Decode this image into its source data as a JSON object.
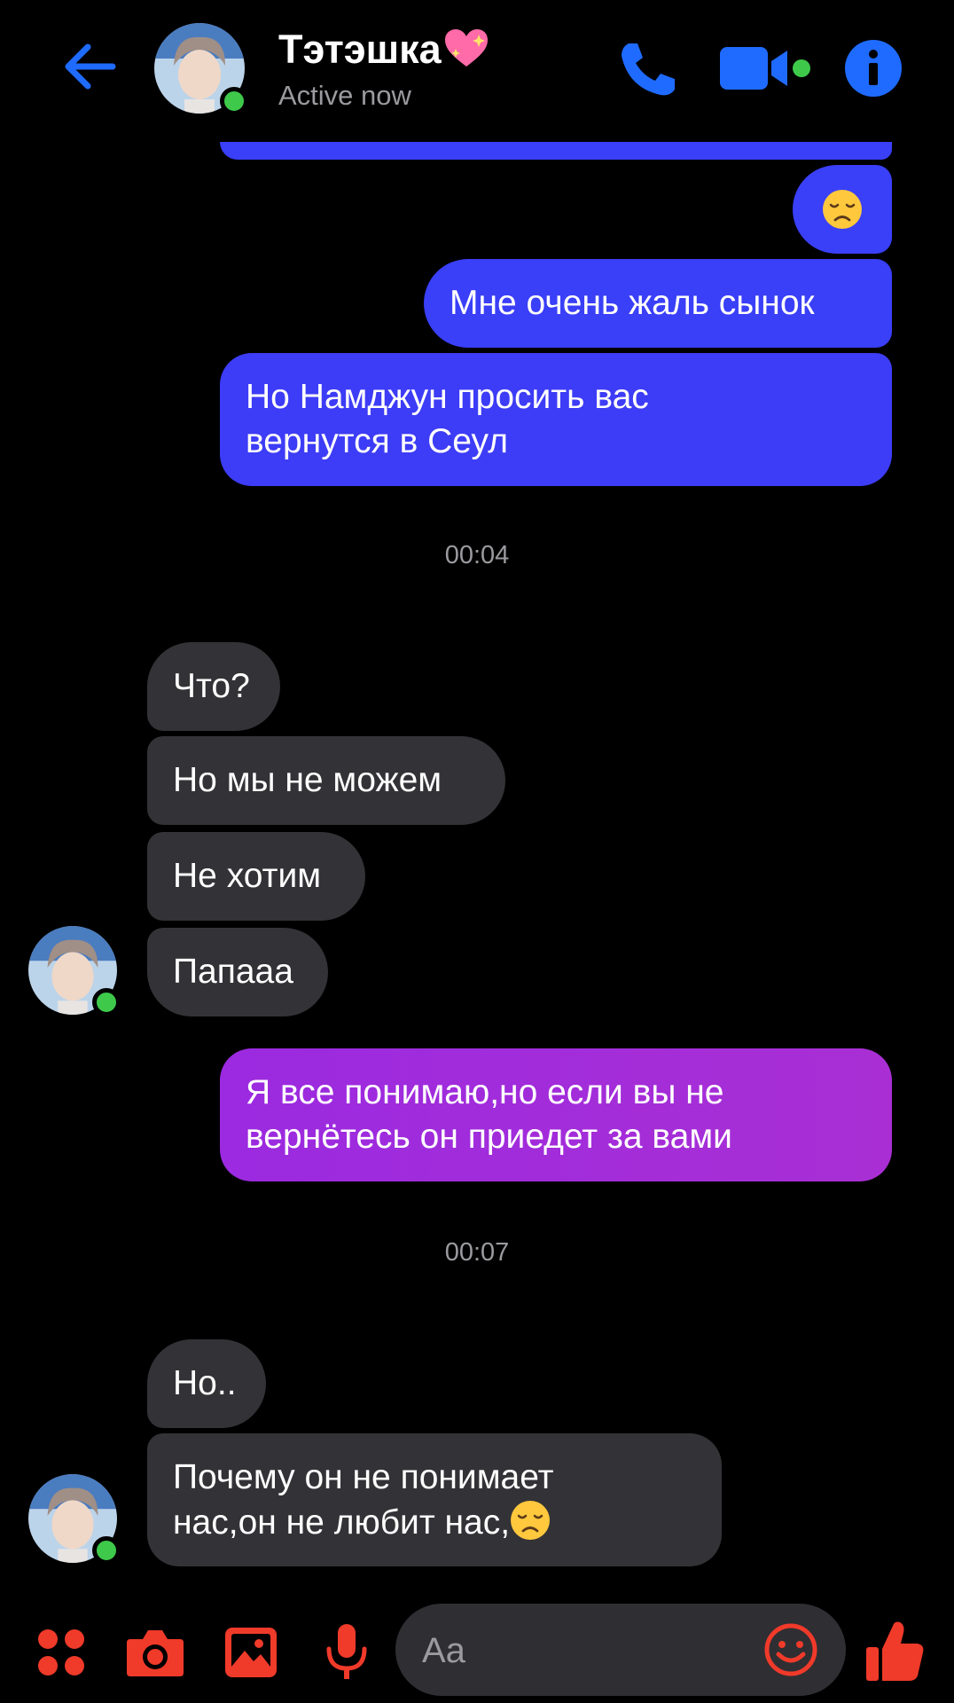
{
  "header": {
    "contact_name": "Тэтэшка",
    "contact_status": "Active now",
    "icons": [
      "back-arrow-icon",
      "phone-icon",
      "video-camera-icon",
      "info-icon"
    ]
  },
  "colors": {
    "accent": "#1f6bff",
    "outgoing_blue": "#3a3ff8",
    "outgoing_purple": "#a12be0",
    "incoming": "#333236",
    "online": "#3ec94b",
    "bottom_icons": "#f03a2a"
  },
  "messages": {
    "m1": "😞",
    "m2": "Мне очень жаль сынок",
    "m3_line1": "Но Намджун просить вас",
    "m3_line2": "вернутся в Сеул",
    "time1": "00:04",
    "m4": "Что?",
    "m5": "Но мы не можем",
    "m6": "Не хотим",
    "m7": "Папааа",
    "m8_line1": "Я все понимаю,но если вы не",
    "m8_line2": "вернётесь он приедет за вами",
    "time2": "00:07",
    "m9": "Но..",
    "m10_line1": "Почему он не понимает",
    "m10_line2": "нас,он не любит нас,"
  },
  "composer": {
    "placeholder": "Aa",
    "icons": [
      "apps-icon",
      "camera-icon",
      "gallery-icon",
      "microphone-icon",
      "emoji-icon",
      "thumbs-up-icon"
    ]
  }
}
